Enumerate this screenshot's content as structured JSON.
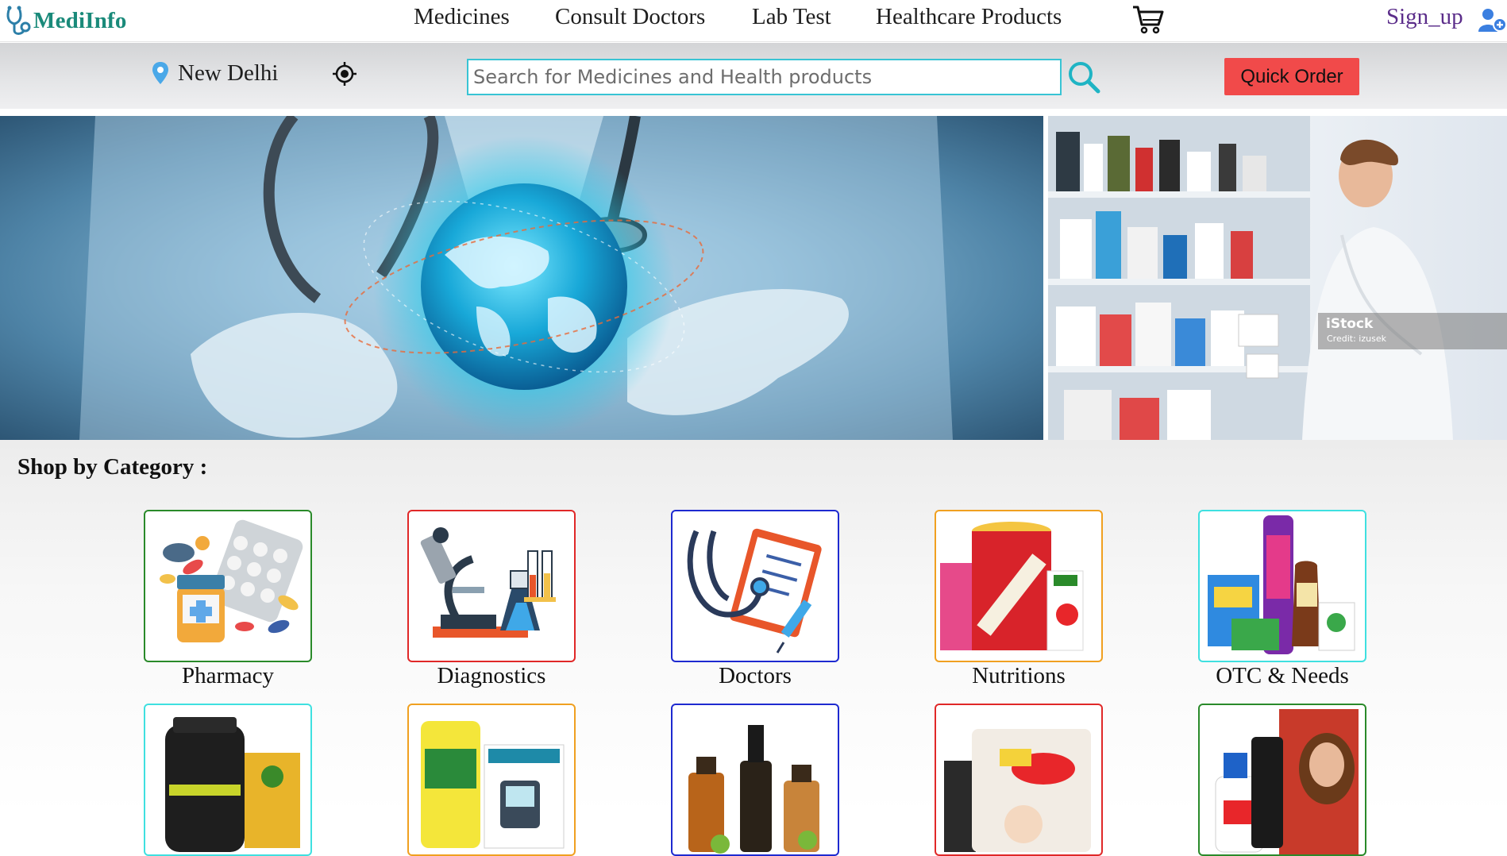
{
  "brand": {
    "name": "MediInfo",
    "color": "#1a8a7a"
  },
  "nav": {
    "items": [
      "Medicines",
      "Consult Doctors",
      "Lab Test",
      "Healthcare Products"
    ],
    "cart_icon": "cart-icon",
    "signup_label": "Sign_up",
    "signup_icon": "user-add-icon"
  },
  "location": {
    "city": "New Delhi",
    "pin_icon": "location-pin-icon",
    "locate_icon": "crosshair-icon"
  },
  "search": {
    "placeholder": "Search for Medicines and Health products",
    "value": "",
    "icon": "search-icon",
    "border_color": "#38c4d4"
  },
  "quick_order": {
    "label": "Quick Order",
    "color": "#f14a4a"
  },
  "banners": {
    "side": {
      "watermark": "iStock",
      "credit": "Credit: izusek"
    }
  },
  "categories": {
    "heading": "Shop by Category :",
    "items": [
      {
        "label": "Pharmacy",
        "border": "#2a8a2a"
      },
      {
        "label": "Diagnostics",
        "border": "#e02828"
      },
      {
        "label": "Doctors",
        "border": "#1e2ad0"
      },
      {
        "label": "Nutritions",
        "border": "#f0a020"
      },
      {
        "label": "OTC & Needs",
        "border": "#3fe0e0"
      },
      {
        "label": "",
        "border": "#3fe0e0"
      },
      {
        "label": "",
        "border": "#f0a020"
      },
      {
        "label": "",
        "border": "#1e2ad0"
      },
      {
        "label": "",
        "border": "#e02828"
      },
      {
        "label": "",
        "border": "#2a8a2a"
      }
    ]
  }
}
